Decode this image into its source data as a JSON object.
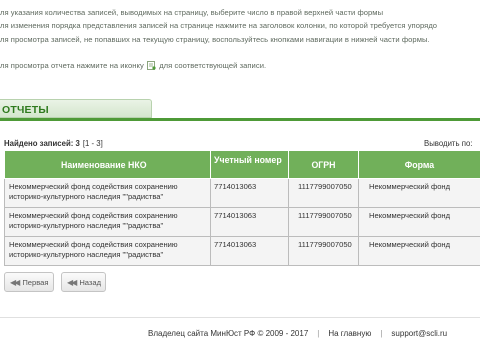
{
  "instructions": {
    "line1": "ля указания количества записей, выводимых на страницу, выберите число в правой верхней части формы",
    "line2": "ля изменения порядка представления записей на странице нажмите на заголовок колонки, по которой требуется упорядо",
    "line3": "ля просмотра записей, не попавших на текущую страницу, воспользуйтесь кнопками навигации в нижней части формы.",
    "line4_before": "ля просмотра отчета нажмите на иконку",
    "line4_after": "для соответствующей записи.",
    "report_icon": "report-icon"
  },
  "section": {
    "title": "ОТЧЕТЫ"
  },
  "results": {
    "found_label": "Найдено записей: 3",
    "range": "[1 - 3]",
    "per_page_label": "Выводить по:"
  },
  "table": {
    "headers": [
      "Наименование НКО",
      "Учетный номер",
      "ОГРН",
      "Форма"
    ],
    "rows": [
      {
        "name_line1": "Некоммерческий фонд содействия сохранению",
        "name_line2": "историко-культурного наследия \"\"радиства\"",
        "reg_no": "7714013063",
        "ogrn": "1117799007050",
        "form": "Некоммерческий фонд"
      },
      {
        "name_line1": "Некоммерческий фонд содействия сохранению",
        "name_line2": "историко-культурного наследия \"\"радиства\"",
        "reg_no": "7714013063",
        "ogrn": "1117799007050",
        "form": "Некоммерческий фонд"
      },
      {
        "name_line1": "Некоммерческий фонд содействия сохранению",
        "name_line2": "историко-культурного наследия \"\"радиства\"",
        "reg_no": "7714013063",
        "ogrn": "1117799007050",
        "form": "Некоммерческий фонд"
      }
    ]
  },
  "pager": {
    "first_label": "Первая",
    "prev_label": "Назад",
    "arrow_icon": "double-left-arrow-icon"
  },
  "footer": {
    "owner_text": "Владелец сайта МинЮст РФ © 2009 - 2017",
    "home_link": "На главную",
    "separator": "|",
    "support_email": "support@scli.ru"
  },
  "colors": {
    "header_green": "#71b05a",
    "title_green": "#2f7a1e",
    "rule_green": "#4e9a37"
  }
}
